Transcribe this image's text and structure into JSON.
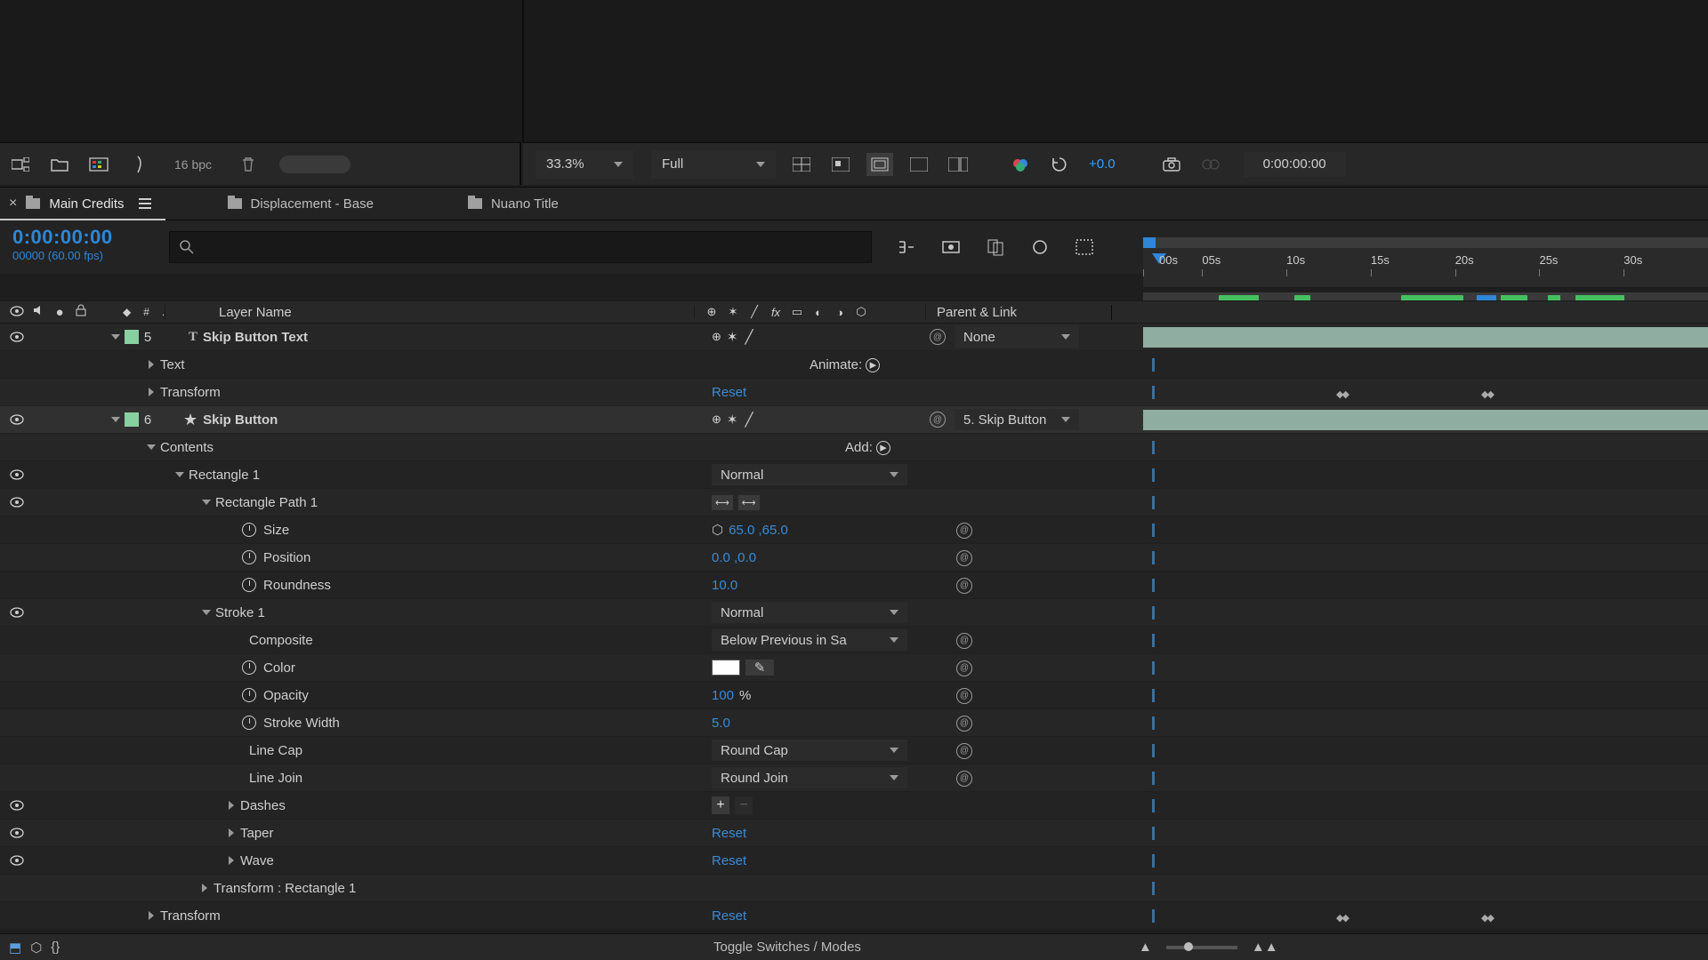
{
  "projectToolbar": {
    "bpc": "16 bpc"
  },
  "viewerToolbar": {
    "zoom": "33.3%",
    "resolution": "Full",
    "exposure": "+0.0",
    "timecode": "0:00:00:00"
  },
  "tabs": [
    {
      "label": "Main Credits",
      "active": true
    },
    {
      "label": "Displacement - Base",
      "active": false
    },
    {
      "label": "Nuano Title",
      "active": false
    }
  ],
  "timelineHeader": {
    "timecode": "0:00:00:00",
    "frameinfo": "00000 (60.00 fps)"
  },
  "ruler": {
    "ticks": [
      "00s",
      "05s",
      "10s",
      "15s",
      "20s",
      "25s",
      "30s"
    ]
  },
  "columnHeaders": {
    "layerName": "Layer Name",
    "parentLink": "Parent & Link"
  },
  "rows": {
    "animateLabel": "Animate:",
    "addLabel": "Add:",
    "resetLabel": "Reset",
    "layer5": {
      "index": "5",
      "name": "Skip Button Text",
      "parent": "None"
    },
    "l5_text": "Text",
    "l5_transform": "Transform",
    "layer6": {
      "index": "6",
      "name": "Skip Button",
      "parent": "5. Skip Button"
    },
    "l6_contents": "Contents",
    "rect1": "Rectangle 1",
    "rectpath1": "Rectangle Path 1",
    "size": {
      "label": "Size",
      "value": "65.0 ,65.0"
    },
    "position": {
      "label": "Position",
      "value": "0.0 ,0.0"
    },
    "roundness": {
      "label": "Roundness",
      "value": "10.0"
    },
    "stroke1": "Stroke 1",
    "composite": {
      "label": "Composite",
      "value": "Below Previous in Sa"
    },
    "color": {
      "label": "Color",
      "swatch": "#ffffff"
    },
    "opacity": {
      "label": "Opacity",
      "value": "100",
      "unit": "%"
    },
    "strokewidth": {
      "label": "Stroke Width",
      "value": "5.0"
    },
    "linecap": {
      "label": "Line Cap",
      "value": "Round Cap"
    },
    "linejoin": {
      "label": "Line Join",
      "value": "Round Join"
    },
    "dashes": "Dashes",
    "taper": "Taper",
    "wave": "Wave",
    "transformRect": "Transform : Rectangle 1",
    "transform": "Transform",
    "normal": "Normal"
  },
  "footer": {
    "toggle": "Toggle Switches / Modes"
  }
}
